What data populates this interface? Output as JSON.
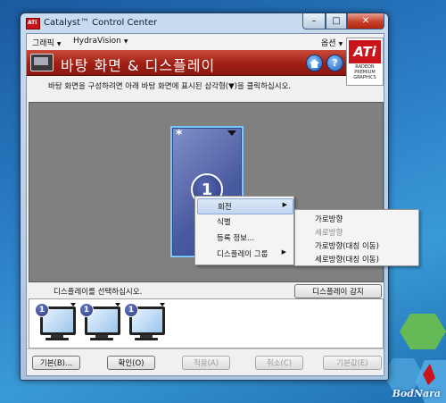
{
  "window": {
    "title": "Catalyst™ Control Center",
    "controls": {
      "minimize": "–",
      "maximize": "□",
      "close": "✕"
    }
  },
  "menubar": {
    "graphics": "그래픽",
    "hydravision": "HydraVision",
    "options": "옵션"
  },
  "banner": {
    "title": "바탕 화면 & 디스플레이",
    "home_icon": "home-icon",
    "help_icon": "?",
    "logo": {
      "brand": "ATi",
      "sub": "RADEON\nPREMIUM\nGRAPHICS"
    }
  },
  "instruction": "바탕 화면을 구성하려면 아래 바탕 화면에 표시된 삼각형(▼)을 클릭하십시오.",
  "desktop_tile": {
    "star": "*",
    "number": "1"
  },
  "context_menu": {
    "items": [
      {
        "label": "회전",
        "submenu": true,
        "arrow": "▶"
      },
      {
        "label": "식별",
        "submenu": false,
        "arrow": ""
      },
      {
        "label": "등록 정보...",
        "submenu": false,
        "arrow": ""
      },
      {
        "label": "디스플레이 그룹",
        "submenu": true,
        "arrow": "▶"
      }
    ]
  },
  "rotation_submenu": {
    "items": [
      {
        "label": "가로방향",
        "disabled": false
      },
      {
        "label": "세로방향",
        "disabled": true
      },
      {
        "label": "가로방향(대칭 이동)",
        "disabled": false
      },
      {
        "label": "세로방향(대칭 이동)",
        "disabled": false
      }
    ]
  },
  "display_select": {
    "label": "디스플레이를 선택하십시오.",
    "detect_button": "디스플레이 감지",
    "monitors": [
      {
        "number": "1"
      },
      {
        "number": "1"
      },
      {
        "number": "1"
      }
    ]
  },
  "buttons": {
    "defaults": "기본(B)...",
    "ok": "확인(O)",
    "apply": "적용(A)",
    "cancel": "취소(C)",
    "reset": "기본값(E)"
  },
  "desktop": {
    "watermark": "BodNara"
  },
  "colors": {
    "banner_red": "#a01f15",
    "ati_red": "#c8141a",
    "tile_blue": "#4a5aa0",
    "highlight": "#c4d8f2",
    "desktop_blue": "#2a7cc4"
  }
}
